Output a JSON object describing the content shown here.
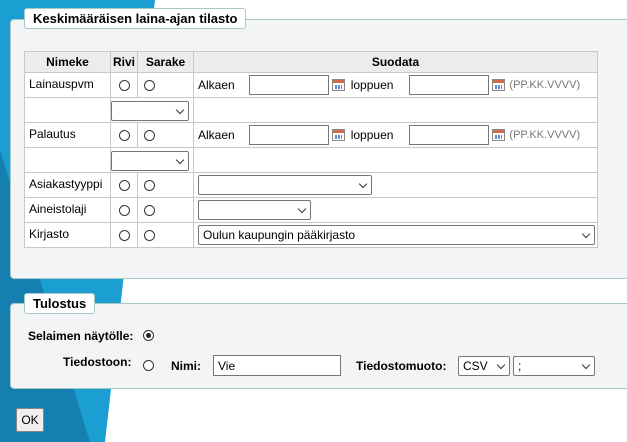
{
  "stats_panel": {
    "title": "Keskimääräisen laina-ajan tilasto",
    "headers": {
      "name": "Nimeke",
      "row": "Rivi",
      "column": "Sarake",
      "filter": "Suodata"
    },
    "lainauspvm": {
      "label": "Lainauspvm",
      "from": "Alkaen",
      "to": "loppuen",
      "format": "(PP.KK.VVVV)",
      "from_value": "",
      "to_value": "",
      "select_value": ""
    },
    "palautus": {
      "label": "Palautus",
      "from": "Alkaen",
      "to": "loppuen",
      "format": "(PP.KK.VVVV)",
      "from_value": "",
      "to_value": "",
      "select_value": ""
    },
    "asiakastyyppi": {
      "label": "Asiakastyyppi",
      "value": ""
    },
    "aineistolaji": {
      "label": "Aineistolaji",
      "value": ""
    },
    "kirjasto": {
      "label": "Kirjasto",
      "value": "Oulun kaupungin pääkirjasto"
    }
  },
  "output_panel": {
    "title": "Tulostus",
    "browser_label": "Selaimen näytölle:",
    "file_label": "Tiedostoon:",
    "name_label": "Nimi:",
    "name_value": "Vie",
    "format_label": "Tiedostomuoto:",
    "format_value": "CSV",
    "separator_value": ";"
  },
  "ok_button": "OK",
  "colors": {
    "accent": "#1b9ed2",
    "panel_border": "#a9c7c9",
    "panel_bg": "#f2f4f5"
  }
}
